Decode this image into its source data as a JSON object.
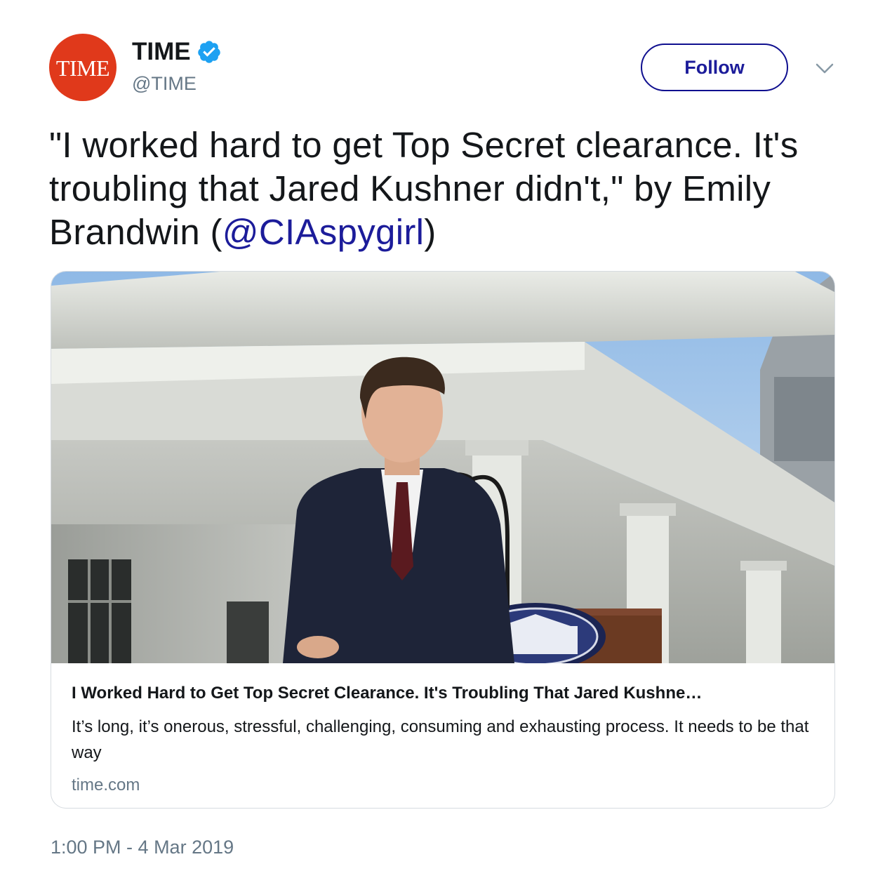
{
  "account": {
    "avatar_text": "TIME",
    "display_name": "TIME",
    "handle": "@TIME",
    "verified": true
  },
  "actions": {
    "follow_label": "Follow"
  },
  "tweet": {
    "text_before": "\"I worked hard to get Top Secret clearance. It's troubling that Jared Kushner didn't,\" by Emily Brandwin (",
    "mention": "@CIAspygirl",
    "text_after": ")",
    "timestamp": "1:00 PM - 4 Mar 2019"
  },
  "card": {
    "title": "I Worked Hard to Get Top Secret Clearance. It's Troubling That Jared Kushne…",
    "description": "It’s long, it’s onerous, stressful, challenging, consuming and exhausting process. It needs to be that way",
    "domain": "time.com"
  },
  "colors": {
    "brand_red": "#e0391b",
    "link_blue": "#1c1c9a",
    "verified_blue": "#1da1f2",
    "muted_gray": "#657786"
  },
  "icons": {
    "verified": "verified-badge-icon",
    "more": "chevron-down-icon"
  }
}
